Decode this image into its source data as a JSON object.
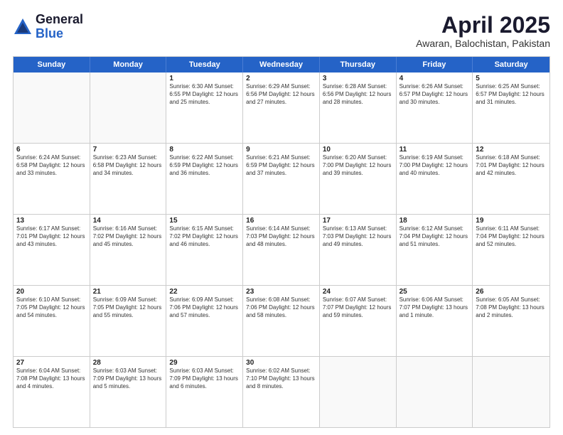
{
  "logo": {
    "general": "General",
    "blue": "Blue"
  },
  "header": {
    "month": "April 2025",
    "location": "Awaran, Balochistan, Pakistan"
  },
  "days": [
    "Sunday",
    "Monday",
    "Tuesday",
    "Wednesday",
    "Thursday",
    "Friday",
    "Saturday"
  ],
  "weeks": [
    [
      {
        "day": "",
        "info": ""
      },
      {
        "day": "",
        "info": ""
      },
      {
        "day": "1",
        "info": "Sunrise: 6:30 AM\nSunset: 6:55 PM\nDaylight: 12 hours and 25 minutes."
      },
      {
        "day": "2",
        "info": "Sunrise: 6:29 AM\nSunset: 6:56 PM\nDaylight: 12 hours and 27 minutes."
      },
      {
        "day": "3",
        "info": "Sunrise: 6:28 AM\nSunset: 6:56 PM\nDaylight: 12 hours and 28 minutes."
      },
      {
        "day": "4",
        "info": "Sunrise: 6:26 AM\nSunset: 6:57 PM\nDaylight: 12 hours and 30 minutes."
      },
      {
        "day": "5",
        "info": "Sunrise: 6:25 AM\nSunset: 6:57 PM\nDaylight: 12 hours and 31 minutes."
      }
    ],
    [
      {
        "day": "6",
        "info": "Sunrise: 6:24 AM\nSunset: 6:58 PM\nDaylight: 12 hours and 33 minutes."
      },
      {
        "day": "7",
        "info": "Sunrise: 6:23 AM\nSunset: 6:58 PM\nDaylight: 12 hours and 34 minutes."
      },
      {
        "day": "8",
        "info": "Sunrise: 6:22 AM\nSunset: 6:59 PM\nDaylight: 12 hours and 36 minutes."
      },
      {
        "day": "9",
        "info": "Sunrise: 6:21 AM\nSunset: 6:59 PM\nDaylight: 12 hours and 37 minutes."
      },
      {
        "day": "10",
        "info": "Sunrise: 6:20 AM\nSunset: 7:00 PM\nDaylight: 12 hours and 39 minutes."
      },
      {
        "day": "11",
        "info": "Sunrise: 6:19 AM\nSunset: 7:00 PM\nDaylight: 12 hours and 40 minutes."
      },
      {
        "day": "12",
        "info": "Sunrise: 6:18 AM\nSunset: 7:01 PM\nDaylight: 12 hours and 42 minutes."
      }
    ],
    [
      {
        "day": "13",
        "info": "Sunrise: 6:17 AM\nSunset: 7:01 PM\nDaylight: 12 hours and 43 minutes."
      },
      {
        "day": "14",
        "info": "Sunrise: 6:16 AM\nSunset: 7:02 PM\nDaylight: 12 hours and 45 minutes."
      },
      {
        "day": "15",
        "info": "Sunrise: 6:15 AM\nSunset: 7:02 PM\nDaylight: 12 hours and 46 minutes."
      },
      {
        "day": "16",
        "info": "Sunrise: 6:14 AM\nSunset: 7:03 PM\nDaylight: 12 hours and 48 minutes."
      },
      {
        "day": "17",
        "info": "Sunrise: 6:13 AM\nSunset: 7:03 PM\nDaylight: 12 hours and 49 minutes."
      },
      {
        "day": "18",
        "info": "Sunrise: 6:12 AM\nSunset: 7:04 PM\nDaylight: 12 hours and 51 minutes."
      },
      {
        "day": "19",
        "info": "Sunrise: 6:11 AM\nSunset: 7:04 PM\nDaylight: 12 hours and 52 minutes."
      }
    ],
    [
      {
        "day": "20",
        "info": "Sunrise: 6:10 AM\nSunset: 7:05 PM\nDaylight: 12 hours and 54 minutes."
      },
      {
        "day": "21",
        "info": "Sunrise: 6:09 AM\nSunset: 7:05 PM\nDaylight: 12 hours and 55 minutes."
      },
      {
        "day": "22",
        "info": "Sunrise: 6:09 AM\nSunset: 7:06 PM\nDaylight: 12 hours and 57 minutes."
      },
      {
        "day": "23",
        "info": "Sunrise: 6:08 AM\nSunset: 7:06 PM\nDaylight: 12 hours and 58 minutes."
      },
      {
        "day": "24",
        "info": "Sunrise: 6:07 AM\nSunset: 7:07 PM\nDaylight: 12 hours and 59 minutes."
      },
      {
        "day": "25",
        "info": "Sunrise: 6:06 AM\nSunset: 7:07 PM\nDaylight: 13 hours and 1 minute."
      },
      {
        "day": "26",
        "info": "Sunrise: 6:05 AM\nSunset: 7:08 PM\nDaylight: 13 hours and 2 minutes."
      }
    ],
    [
      {
        "day": "27",
        "info": "Sunrise: 6:04 AM\nSunset: 7:08 PM\nDaylight: 13 hours and 4 minutes."
      },
      {
        "day": "28",
        "info": "Sunrise: 6:03 AM\nSunset: 7:09 PM\nDaylight: 13 hours and 5 minutes."
      },
      {
        "day": "29",
        "info": "Sunrise: 6:03 AM\nSunset: 7:09 PM\nDaylight: 13 hours and 6 minutes."
      },
      {
        "day": "30",
        "info": "Sunrise: 6:02 AM\nSunset: 7:10 PM\nDaylight: 13 hours and 8 minutes."
      },
      {
        "day": "",
        "info": ""
      },
      {
        "day": "",
        "info": ""
      },
      {
        "day": "",
        "info": ""
      }
    ]
  ]
}
